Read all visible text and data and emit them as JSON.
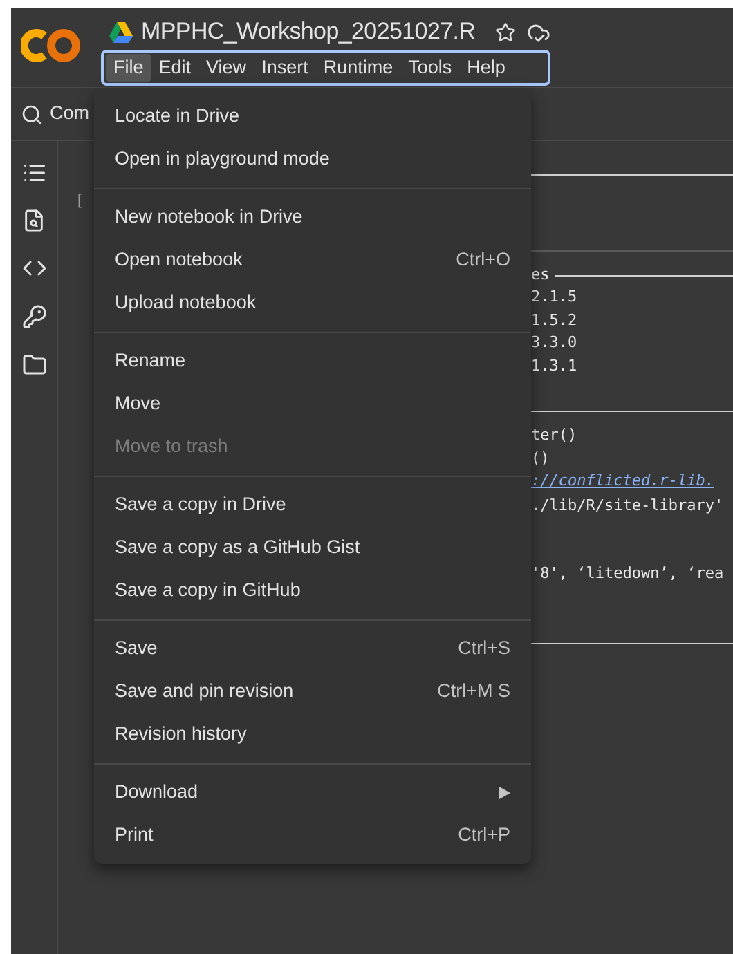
{
  "header": {
    "title": "MPPHC_Workshop_20251027.R",
    "menubar": [
      {
        "label": "File",
        "selected": true
      },
      {
        "label": "Edit",
        "selected": false
      },
      {
        "label": "View",
        "selected": false
      },
      {
        "label": "Insert",
        "selected": false
      },
      {
        "label": "Runtime",
        "selected": false
      },
      {
        "label": "Tools",
        "selected": false
      },
      {
        "label": "Help",
        "selected": false
      }
    ]
  },
  "toolbar": {
    "search_label": "Com"
  },
  "cell": {
    "bracket": "["
  },
  "output": {
    "groups": [
      {
        "rule_after": true,
        "lines": [
          {
            "kind": "heading",
            "text": "es"
          },
          {
            "kind": "code",
            "text": "2.1.5"
          },
          {
            "kind": "code",
            "text": "1.5.2"
          },
          {
            "kind": "code",
            "text": "3.3.0"
          },
          {
            "kind": "code",
            "text": "1.3.1"
          }
        ]
      },
      {
        "rule_after": false,
        "lines": [
          {
            "kind": "code",
            "text": "ter()"
          },
          {
            "kind": "code",
            "text": "()"
          },
          {
            "kind": "link",
            "text": "://conflicted.r-lib."
          },
          {
            "kind": "code",
            "text": "./lib/R/site-library'"
          }
        ]
      },
      {
        "rule_after": true,
        "lines": [
          {
            "kind": "code",
            "text": "'8', ‘litedown’, ‘rea"
          }
        ]
      }
    ]
  },
  "file_menu": {
    "groups": [
      [
        {
          "label": "Locate in Drive",
          "disabled": false
        },
        {
          "label": "Open in playground mode",
          "disabled": false
        }
      ],
      [
        {
          "label": "New notebook in Drive",
          "disabled": false
        },
        {
          "label": "Open notebook",
          "shortcut": "Ctrl+O",
          "disabled": false
        },
        {
          "label": "Upload notebook",
          "disabled": false
        }
      ],
      [
        {
          "label": "Rename",
          "disabled": false
        },
        {
          "label": "Move",
          "disabled": false
        },
        {
          "label": "Move to trash",
          "disabled": true
        }
      ],
      [
        {
          "label": "Save a copy in Drive",
          "disabled": false
        },
        {
          "label": "Save a copy as a GitHub Gist",
          "disabled": false
        },
        {
          "label": "Save a copy in GitHub",
          "disabled": false
        }
      ],
      [
        {
          "label": "Save",
          "shortcut": "Ctrl+S",
          "disabled": false
        },
        {
          "label": "Save and pin revision",
          "shortcut": "Ctrl+M S",
          "disabled": false
        },
        {
          "label": "Revision history",
          "disabled": false
        }
      ],
      [
        {
          "label": "Download",
          "submenu": true,
          "disabled": false
        },
        {
          "label": "Print",
          "shortcut": "Ctrl+P",
          "disabled": false
        }
      ]
    ]
  }
}
